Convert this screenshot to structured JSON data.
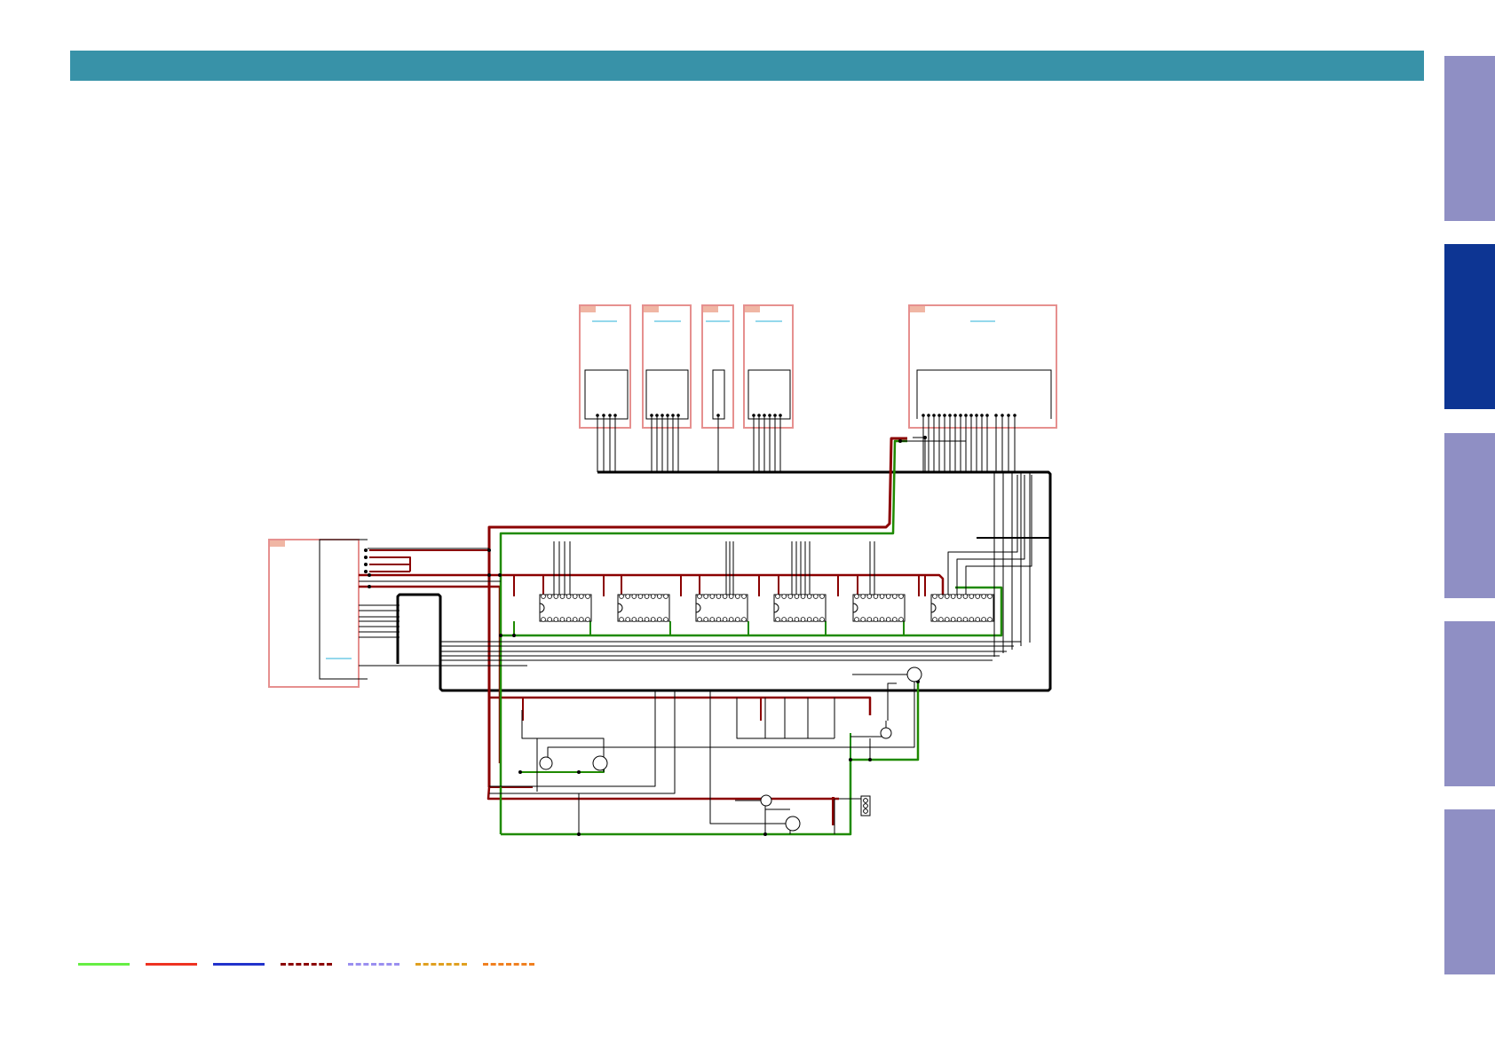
{
  "colors": {
    "header": "#3892a8",
    "tab_inactive": "#8f8fc4",
    "tab_active": "#0d3593",
    "box_border": "#e6908f",
    "box_tag": "#f0b6a4",
    "wire_black": "#000000",
    "wire_red": "#8b0000",
    "wire_green": "#1f8a00",
    "label_blue": "#2ab0d8"
  },
  "side_tabs": [
    {
      "state": "inactive"
    },
    {
      "state": "active"
    },
    {
      "state": "inactive"
    },
    {
      "state": "inactive"
    },
    {
      "state": "inactive"
    }
  ],
  "legend": [
    {
      "color": "#66ee44",
      "style": "solid"
    },
    {
      "color": "#ee3322",
      "style": "solid"
    },
    {
      "color": "#2233cc",
      "style": "solid"
    },
    {
      "color": "#8b0000",
      "style": "dashed"
    },
    {
      "color": "#9a8ff0",
      "style": "dashed"
    },
    {
      "color": "#e0a020",
      "style": "dashed"
    },
    {
      "color": "#f08020",
      "style": "dashed"
    }
  ]
}
